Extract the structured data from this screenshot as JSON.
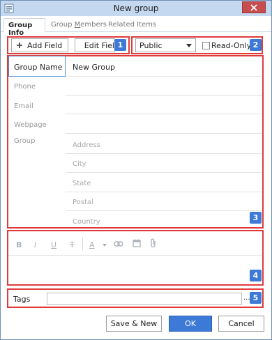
{
  "window": {
    "title": "New group"
  },
  "tabs": [
    {
      "label": "Group Info"
    },
    {
      "label_pre": "Group ",
      "label_ul": "M",
      "label_post": "embers"
    },
    {
      "label": "Related Items"
    }
  ],
  "toolbar": {
    "add_field": "Add Field",
    "edit_field": "Edit Fiel",
    "visibility": "Public",
    "read_only": "Read-Only"
  },
  "annotations": [
    "1",
    "2",
    "3",
    "4",
    "5"
  ],
  "fields": {
    "group_name_label": "Group Name",
    "group_name_value": "New Group",
    "phone_label": "Phone",
    "email_label": "Email",
    "webpage_label": "Webpage",
    "group_label": "Group"
  },
  "address_placeholders": {
    "address": "Address",
    "city": "City",
    "state": "State",
    "postal": "Postal",
    "country": "Country"
  },
  "format_toolbar": {
    "bold": "B",
    "italic": "I",
    "underline": "U",
    "strike": "T",
    "font_color": "A"
  },
  "tags": {
    "label": "Tags",
    "more": "..."
  },
  "footer": {
    "save_new": "Save & New",
    "ok": "OK",
    "cancel": "Cancel"
  }
}
